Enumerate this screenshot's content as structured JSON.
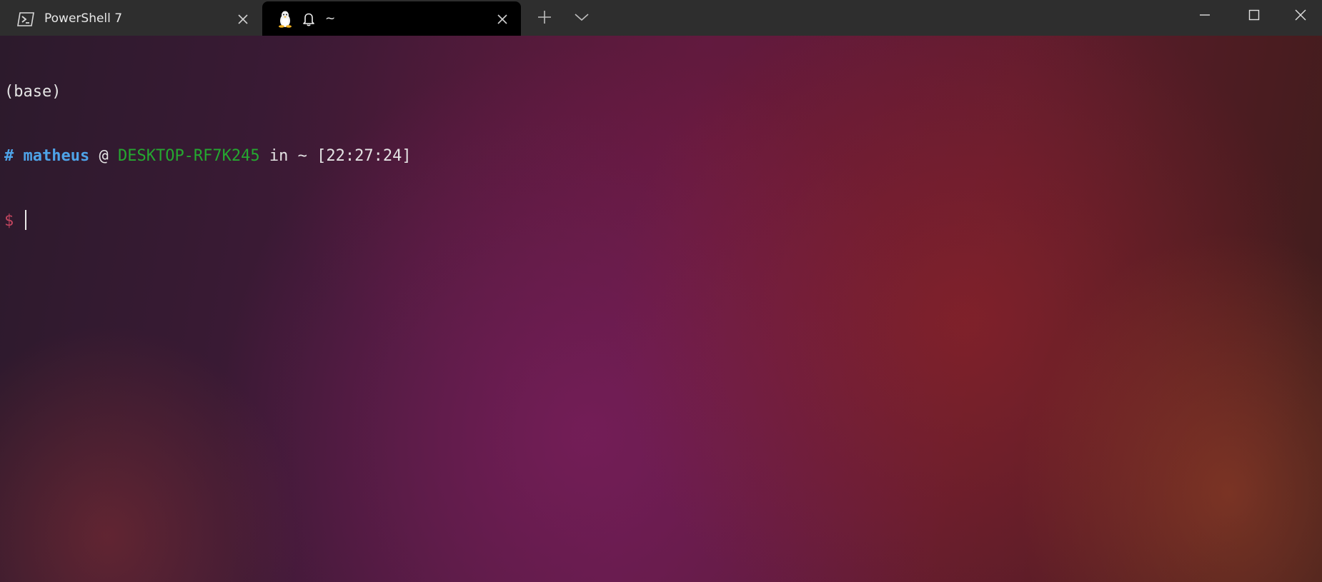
{
  "tabs": [
    {
      "label": "PowerShell 7",
      "icon": "powershell-icon",
      "active": false
    },
    {
      "label": "~",
      "icon": "linux-penguin-icon",
      "active": true,
      "bell": "bell-icon"
    }
  ],
  "tabbar": {
    "new_tab_icon": "plus-icon",
    "dropdown_icon": "chevron-down-icon"
  },
  "window_controls": {
    "minimize_icon": "minimize-icon",
    "maximize_icon": "maximize-icon",
    "close_icon": "close-icon"
  },
  "terminal": {
    "env_line": "(base)",
    "prompt": {
      "hash": "#",
      "user": "matheus",
      "at": "@",
      "host": "DESKTOP-RF7K245",
      "in": "in",
      "dir": "~",
      "time": "[22:27:24]"
    },
    "input_prompt": "$"
  },
  "colors": {
    "tabbar_bg": "#2e2e2e",
    "active_tab_bg": "#000000",
    "user": "#4ea3e8",
    "host": "#25a830",
    "dollar": "#c2455f"
  }
}
